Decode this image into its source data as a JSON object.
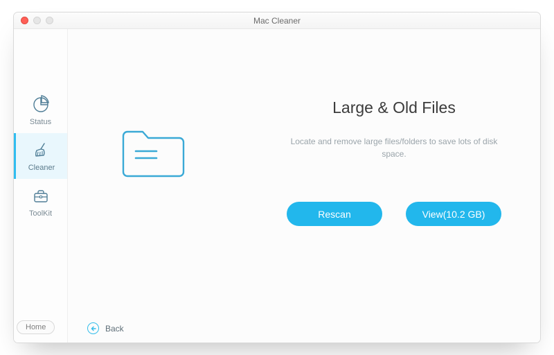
{
  "window": {
    "title": "Mac Cleaner"
  },
  "sidebar": {
    "items": [
      {
        "label": "Status"
      },
      {
        "label": "Cleaner"
      },
      {
        "label": "ToolKit"
      }
    ],
    "home": "Home"
  },
  "back": {
    "label": "Back"
  },
  "panel": {
    "heading": "Large & Old Files",
    "description": "Locate and remove large files/folders to save lots of disk space."
  },
  "actions": {
    "rescan": "Rescan",
    "view": "View(10.2 GB)"
  },
  "colors": {
    "accent": "#22b7ec",
    "icon": "#3aa9d6"
  }
}
